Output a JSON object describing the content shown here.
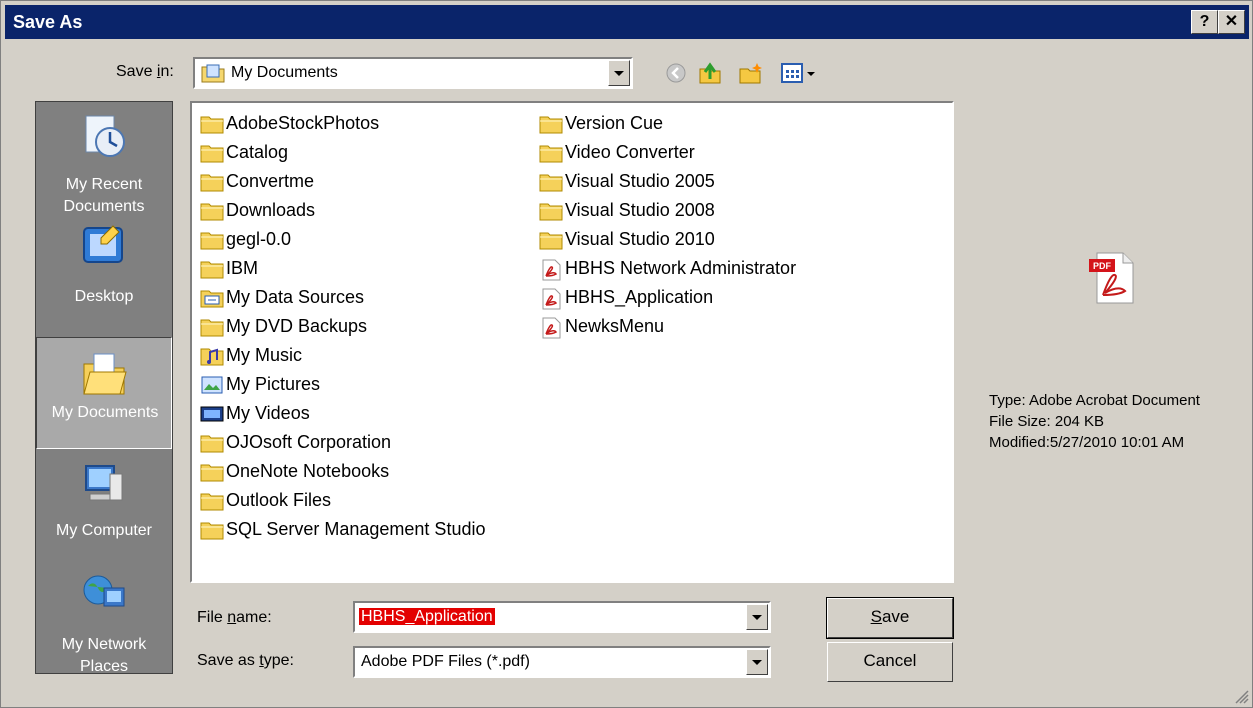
{
  "window": {
    "title": "Save As",
    "help_btn": "?",
    "close_btn": "✕"
  },
  "save_in": {
    "label_pre": "Save ",
    "label_u": "i",
    "label_post": "n:",
    "value": "My Documents"
  },
  "toolbar": {
    "icons": [
      "back-icon",
      "up-folder-icon",
      "new-folder-icon",
      "views-menu-icon"
    ]
  },
  "places": [
    {
      "label": "My Recent Documents",
      "icon": "recent-documents-icon"
    },
    {
      "label": "Desktop",
      "icon": "desktop-icon"
    },
    {
      "label": "My Documents",
      "icon": "my-documents-icon",
      "active": true
    },
    {
      "label": "My Computer",
      "icon": "my-computer-icon"
    },
    {
      "label": "My Network Places",
      "icon": "network-places-icon"
    }
  ],
  "files": [
    {
      "name": "AdobeStockPhotos",
      "type": "folder"
    },
    {
      "name": "Catalog",
      "type": "folder"
    },
    {
      "name": "Convertme",
      "type": "folder"
    },
    {
      "name": "Downloads",
      "type": "folder"
    },
    {
      "name": "gegl-0.0",
      "type": "folder"
    },
    {
      "name": "IBM",
      "type": "folder"
    },
    {
      "name": "My Data Sources",
      "type": "data"
    },
    {
      "name": "My DVD Backups",
      "type": "folder"
    },
    {
      "name": "My Music",
      "type": "music"
    },
    {
      "name": "My Pictures",
      "type": "pictures"
    },
    {
      "name": "My Videos",
      "type": "videos"
    },
    {
      "name": "OJOsoft Corporation",
      "type": "folder"
    },
    {
      "name": "OneNote Notebooks",
      "type": "folder"
    },
    {
      "name": "Outlook Files",
      "type": "folder"
    },
    {
      "name": "SQL Server Management Studio",
      "type": "folder"
    },
    {
      "name": "Version Cue",
      "type": "folder"
    },
    {
      "name": "Video Converter",
      "type": "folder"
    },
    {
      "name": "Visual Studio 2005",
      "type": "folder"
    },
    {
      "name": "Visual Studio 2008",
      "type": "folder"
    },
    {
      "name": "Visual Studio 2010",
      "type": "folder"
    },
    {
      "name": "HBHS Network Administrator",
      "type": "pdf"
    },
    {
      "name": "HBHS_Application",
      "type": "pdf"
    },
    {
      "name": "NewksMenu",
      "type": "pdf"
    }
  ],
  "preview": {
    "type": "Type: Adobe Acrobat Document",
    "size": "File Size: 204 KB",
    "modified": "Modified:5/27/2010 10:01 AM",
    "icon_label": "PDF"
  },
  "file_name": {
    "label_pre": "File ",
    "label_u": "n",
    "label_post": "ame:",
    "value": "HBHS_Application"
  },
  "save_type": {
    "label_pre": "Save as ",
    "label_u": "t",
    "label_post": "ype:",
    "value": "Adobe PDF Files (*.pdf)"
  },
  "buttons": {
    "save_u": "S",
    "save_rest": "ave",
    "cancel": "Cancel"
  },
  "colors": {
    "titlebar": "#0a246a",
    "selection": "#e30000",
    "dialog": "#d4d0c8"
  }
}
